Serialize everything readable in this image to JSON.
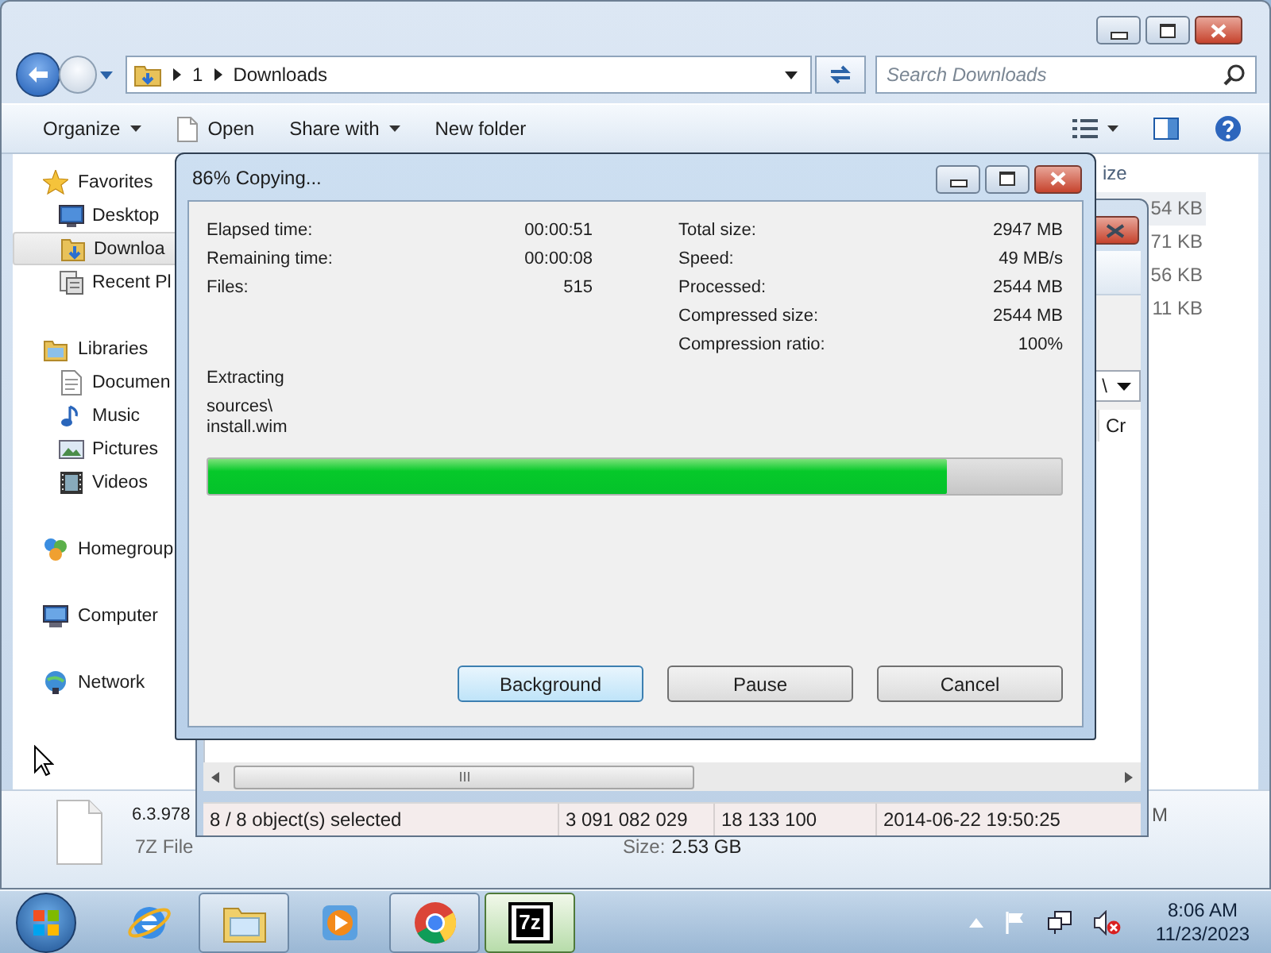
{
  "explorer": {
    "address": {
      "crumbs": [
        "1",
        "Downloads"
      ]
    },
    "search": {
      "placeholder": "Search Downloads"
    },
    "toolbar": [
      {
        "label": "Organize",
        "kind": "menu"
      },
      {
        "label": "Open",
        "kind": "open"
      },
      {
        "label": "Share with",
        "kind": "menu"
      },
      {
        "label": "New folder",
        "kind": "plain"
      }
    ],
    "nav": [
      {
        "label": "Favorites",
        "kind": "star",
        "selected": false,
        "children": [
          {
            "label": "Desktop",
            "kind": "desktop",
            "selected": false
          },
          {
            "label": "Downloa",
            "kind": "download",
            "selected": true
          },
          {
            "label": "Recent Pl",
            "kind": "recent",
            "selected": false
          }
        ]
      },
      {
        "label": "Libraries",
        "kind": "library",
        "selected": false,
        "children": [
          {
            "label": "Documen",
            "kind": "document",
            "selected": false
          },
          {
            "label": "Music",
            "kind": "music",
            "selected": false
          },
          {
            "label": "Pictures",
            "kind": "pictures",
            "selected": false
          },
          {
            "label": "Videos",
            "kind": "videos",
            "selected": false
          }
        ]
      },
      {
        "label": "Homegroup",
        "kind": "homegroup",
        "selected": false
      },
      {
        "label": "Computer",
        "kind": "computer",
        "selected": false
      },
      {
        "label": "Network",
        "kind": "network",
        "selected": false
      }
    ],
    "file_list": {
      "column_header": "ize",
      "rows": [
        {
          "size": "54 KB",
          "selected": true
        },
        {
          "size": "71 KB",
          "selected": false
        },
        {
          "size": "56 KB",
          "selected": false
        },
        {
          "size": "11 KB",
          "selected": false
        }
      ]
    },
    "details": {
      "name": "6.3.978",
      "type": "7Z File",
      "size_label": "Size:",
      "size": "2.53 GB",
      "date_fragment": "M"
    }
  },
  "archive_window": {
    "path": "\\",
    "column_header": "Cr",
    "status": [
      "8 / 8 object(s) selected",
      "3 091 082 029",
      "18 133 100",
      "2014-06-22 19:50:25"
    ]
  },
  "progress_dialog": {
    "title": "86% Copying...",
    "left_stats": [
      {
        "label": "Elapsed time:",
        "value": "00:00:51"
      },
      {
        "label": "Remaining time:",
        "value": "00:00:08"
      },
      {
        "label": "Files:",
        "value": "515"
      }
    ],
    "right_stats": [
      {
        "label": "Total size:",
        "value": "2947 MB"
      },
      {
        "label": "Speed:",
        "value": "49 MB/s"
      },
      {
        "label": "Processed:",
        "value": "2544 MB"
      },
      {
        "label": "Compressed size:",
        "value": "2544 MB"
      },
      {
        "label": "Compression ratio:",
        "value": "100%"
      }
    ],
    "action": "Extracting",
    "current_path": "sources\\",
    "current_file": "install.wim",
    "level": 0.866,
    "buttons": [
      {
        "label": "Background",
        "focused": true
      },
      {
        "label": "Pause",
        "focused": false
      },
      {
        "label": "Cancel",
        "focused": false
      }
    ]
  },
  "taskbar": {
    "apps": [
      {
        "kind": "ie",
        "running": false,
        "active": false
      },
      {
        "kind": "explorer",
        "running": true,
        "active": false
      },
      {
        "kind": "media",
        "running": false,
        "active": false
      },
      {
        "kind": "chrome",
        "running": true,
        "active": false
      },
      {
        "kind": "sevenzip",
        "running": true,
        "active": true,
        "icon_text": "7z"
      }
    ],
    "clock": {
      "time": "8:06 AM",
      "date": "11/23/2023"
    }
  }
}
